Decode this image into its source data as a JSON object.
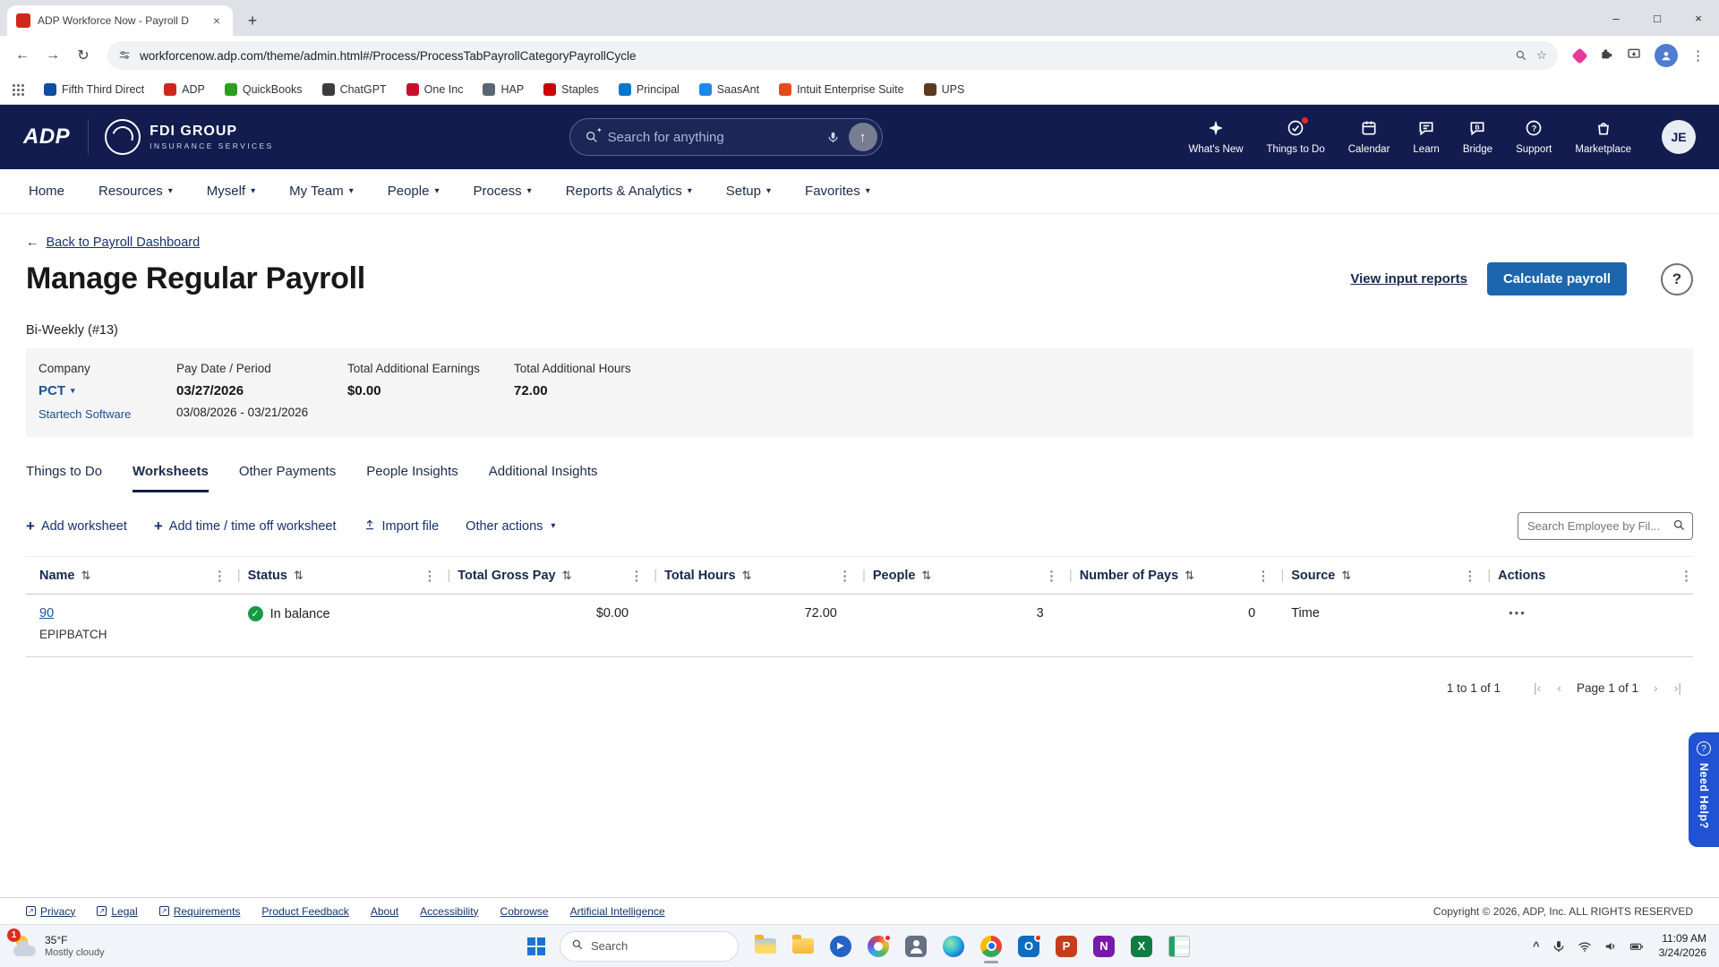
{
  "colors": {
    "header_navy": "#121c4e",
    "accent_blue": "#1b66ad",
    "link_navy": "#1d4f91",
    "status_green": "#149a44",
    "need_help_blue": "#2052d3",
    "badge_red": "#e02b20",
    "adp_red": "#d0271d"
  },
  "browser": {
    "tab_title": "ADP Workforce Now - Payroll D",
    "url": "workforcenow.adp.com/theme/admin.html#/Process/ProcessTabPayrollCategoryPayrollCycle",
    "bookmarks": [
      {
        "label": "Fifth Third Direct",
        "color": "#0d4f9e"
      },
      {
        "label": "ADP",
        "color": "#d0271d"
      },
      {
        "label": "QuickBooks",
        "color": "#2ca01c"
      },
      {
        "label": "ChatGPT",
        "color": "#3c3c3c"
      },
      {
        "label": "One Inc",
        "color": "#c8102e"
      },
      {
        "label": "HAP",
        "color": "#5b6770"
      },
      {
        "label": "Staples",
        "color": "#cc0000"
      },
      {
        "label": "Principal",
        "color": "#0076cf"
      },
      {
        "label": "SaasAnt",
        "color": "#1e88e5"
      },
      {
        "label": "Intuit Enterprise Suite",
        "color": "#e64a19"
      },
      {
        "label": "UPS",
        "color": "#5c3a1e"
      }
    ]
  },
  "header": {
    "logo": "ADP",
    "partner": "FDI GROUP",
    "partner_sub": "INSURANCE SERVICES",
    "search_placeholder": "Search for anything",
    "items": [
      {
        "label": "What's New"
      },
      {
        "label": "Things to Do"
      },
      {
        "label": "Calendar"
      },
      {
        "label": "Learn"
      },
      {
        "label": "Bridge"
      },
      {
        "label": "Support"
      },
      {
        "label": "Marketplace"
      }
    ],
    "avatar": "JE"
  },
  "nav": [
    "Home",
    "Resources",
    "Myself",
    "My Team",
    "People",
    "Process",
    "Reports & Analytics",
    "Setup",
    "Favorites"
  ],
  "page": {
    "back_link": "Back to Payroll Dashboard",
    "title": "Manage Regular Payroll",
    "view_input_reports": "View input reports",
    "calculate_payroll": "Calculate payroll",
    "frequency": "Bi-Weekly (#13)",
    "summary": {
      "company_label": "Company",
      "company_value": "PCT",
      "company_sub": "Startech Software",
      "pay_label": "Pay Date / Period",
      "pay_date": "03/27/2026",
      "pay_period": "03/08/2026 - 03/21/2026",
      "earnings_label": "Total Additional Earnings",
      "earnings_value": "$0.00",
      "hours_label": "Total Additional Hours",
      "hours_value": "72.00"
    },
    "tabs": [
      "Things to Do",
      "Worksheets",
      "Other Payments",
      "People Insights",
      "Additional Insights"
    ],
    "toolbar": {
      "add_worksheet": "Add worksheet",
      "add_time": "Add time / time off worksheet",
      "import_file": "Import file",
      "other_actions": "Other actions",
      "search_placeholder": "Search Employee by Fil..."
    },
    "table": {
      "columns": [
        "Name",
        "Status",
        "Total Gross Pay",
        "Total Hours",
        "People",
        "Number of Pays",
        "Source",
        "Actions"
      ],
      "row": {
        "name": "90",
        "batch": "EPIPBATCH",
        "status": "In balance",
        "gross": "$0.00",
        "hours": "72.00",
        "people": "3",
        "pays": "0",
        "source": "Time"
      }
    },
    "pagination": {
      "range": "1 to 1 of 1",
      "page": "Page 1 of 1"
    }
  },
  "footer": {
    "links": [
      "Privacy",
      "Legal",
      "Requirements",
      "Product Feedback",
      "About",
      "Accessibility",
      "Cobrowse",
      "Artificial Intelligence"
    ],
    "copyright": "Copyright © 2026, ADP, Inc. ALL RIGHTS RESERVED"
  },
  "need_help": "Need Help?",
  "taskbar": {
    "weather_temp": "35°F",
    "weather_desc": "Mostly cloudy",
    "badge": "1",
    "search_placeholder": "Search",
    "apps": [
      "file-explorer",
      "folder",
      "media-player",
      "photos",
      "mail",
      "edge",
      "chrome",
      "outlook",
      "powerpoint",
      "onenote",
      "excel",
      "spreadsheet"
    ],
    "time": "11:09 AM",
    "date": "3/24/2026"
  },
  "icons": {
    "back_arrow": "←",
    "forward_arrow": "→",
    "refresh": "↻",
    "caret_down": "▾",
    "sort": "⇅",
    "kebab": "⋮",
    "divider": "|",
    "ellipsis": "•••",
    "plus": "+",
    "question": "?",
    "check": "✓",
    "up_arrow": "↑",
    "star": "☆",
    "close": "×",
    "minimize": "–",
    "maximize": "□",
    "new_tab": "+",
    "page_first": "|‹",
    "page_prev": "‹",
    "page_next": "›",
    "page_last": "›|",
    "external": "↗",
    "tray_chevron": "^"
  }
}
